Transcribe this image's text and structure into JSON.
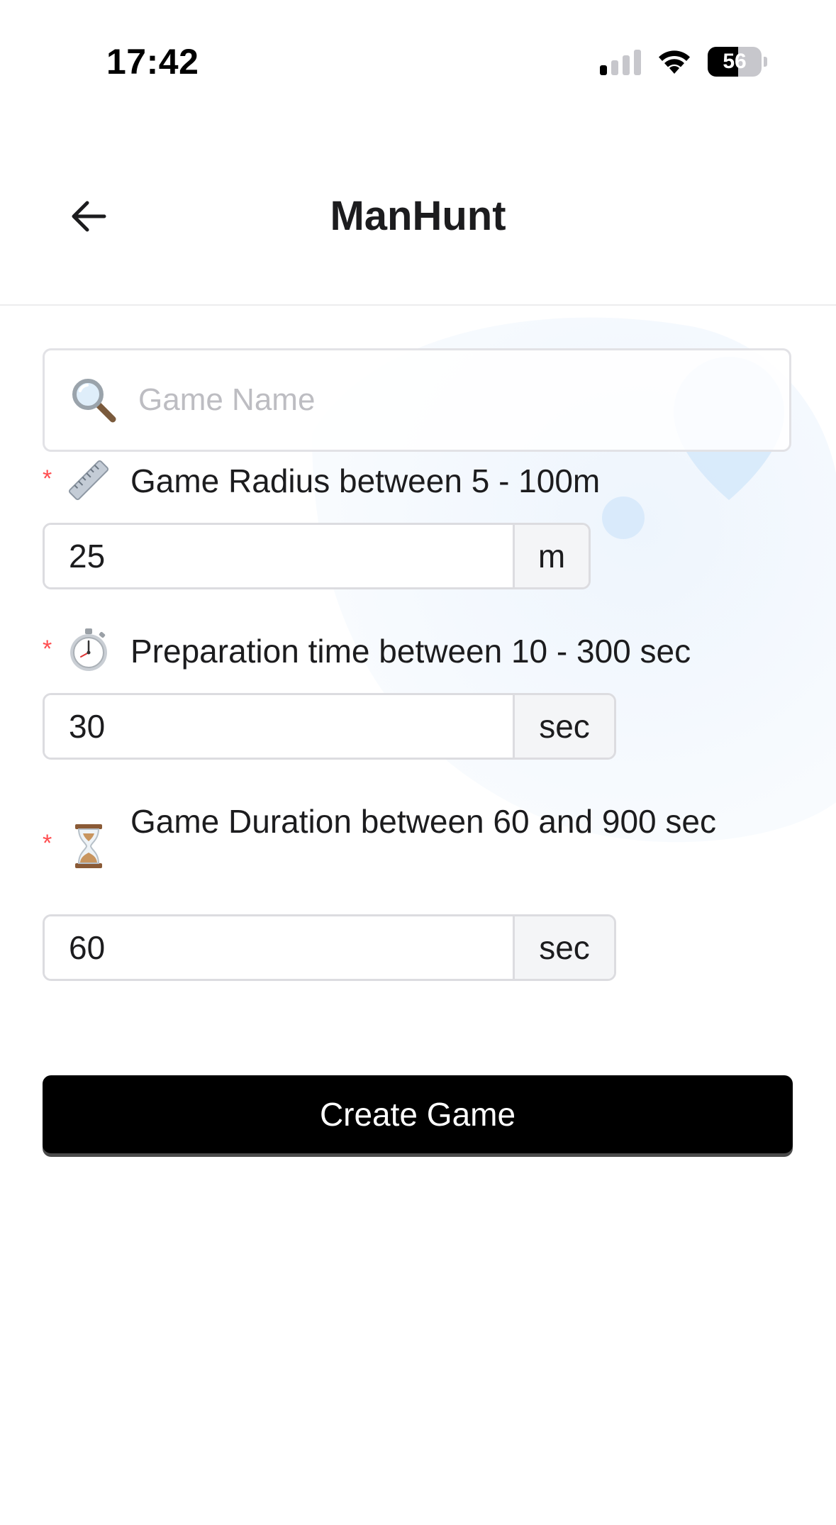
{
  "status_bar": {
    "time": "17:42",
    "battery_percent": "56",
    "battery_level": 0.56,
    "signal_bars_active": 1,
    "signal_bars_total": 4
  },
  "header": {
    "title": "ManHunt",
    "back_icon": "arrow-left-icon"
  },
  "form": {
    "search": {
      "icon": "magnifying-glass-icon",
      "placeholder": "Game Name",
      "value": ""
    },
    "radius": {
      "required_mark": "*",
      "icon": "ruler-icon",
      "label": "Game Radius between 5 - 100m",
      "value": "25",
      "unit": "m"
    },
    "preparation": {
      "required_mark": "*",
      "icon": "stopwatch-icon",
      "label": "Preparation time between 10 - 300 sec",
      "value": "30",
      "unit": "sec"
    },
    "duration": {
      "required_mark": "*",
      "icon": "hourglass-icon",
      "label": "Game Duration between 60 and 900 sec",
      "value": "60",
      "unit": "sec"
    },
    "submit_label": "Create Game"
  },
  "colors": {
    "required": "#ff4d4f",
    "button_bg": "#000000",
    "button_text": "#ffffff",
    "decoration": "#d9ebfb"
  }
}
